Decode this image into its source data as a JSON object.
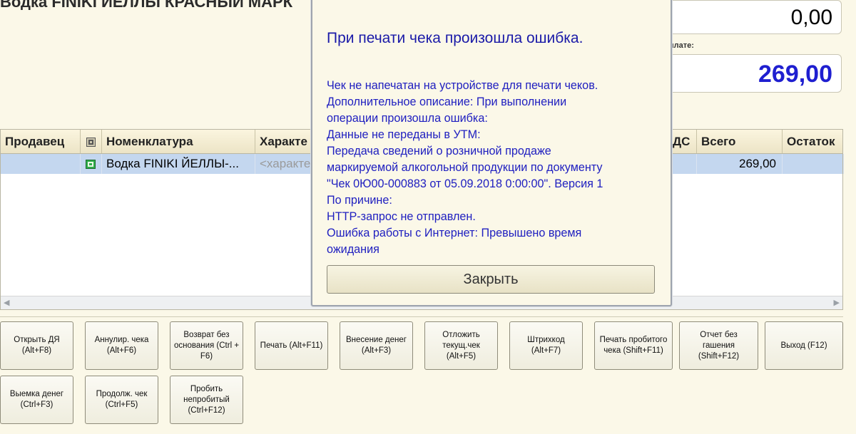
{
  "doc_title": "Водка FINIKI ЙЕЛЛЫ КРАСНЫЙ МАРК",
  "totals": {
    "top_value": "0,00",
    "pay_label": "плате:",
    "pay_value": "269,00"
  },
  "table": {
    "columns": [
      "Продавец",
      "",
      "Номенклатура",
      "Характе",
      "ДС",
      "Всего",
      "Остаток"
    ],
    "rows": [
      {
        "seller": "",
        "item": "Водка FINIKI ЙЕЛЛЫ-...",
        "char": "<характе",
        "nds": "",
        "total": "269,00",
        "rest": ""
      }
    ]
  },
  "buttons_row1": [
    "Открыть ДЯ\n(Alt+F8)",
    "Аннулир. чека\n(Alt+F6)",
    "Возврат без\nоснования (Ctrl +\nF6)",
    "Печать (Alt+F11)",
    "Внесение денег\n(Alt+F3)",
    "Отложить\nтекущ.чек (Alt+F5)",
    "Штрихкод (Alt+F7)",
    "Печать пробитого\nчека (Shift+F11)",
    "Отчет без\nгашения\n(Shift+F12)",
    "Выход (F12)"
  ],
  "buttons_row2": [
    "Выемка денег\n(Ctrl+F3)",
    "Продолж. чек\n(Ctrl+F5)",
    "Пробить\nнепробитый\n(Ctrl+F12)"
  ],
  "dialog": {
    "title": "При печати чека произошла ошибка.",
    "lines": [
      "Чек не напечатан на устройстве для печати чеков.",
      "Дополнительное описание: При выполнении",
      "операции произошла ошибка:",
      "Данные не переданы в УТМ:",
      "Передача сведений о розничной продаже",
      "маркируемой алкогольной продукции по документу",
      "\"Чек 0Ю00-000883 от 05.09.2018 0:00:00\". Версия 1",
      "По причине:",
      "HTTP-запрос не отправлен.",
      "Ошибка работы с Интернет:   Превышено время",
      "ожидания"
    ],
    "close_label": "Закрыть"
  },
  "colors": {
    "background": "#fbf8e8",
    "dialog_text": "#2020c0",
    "pay_value": "#1f1fd0",
    "selected_row": "#c4d7ef"
  }
}
